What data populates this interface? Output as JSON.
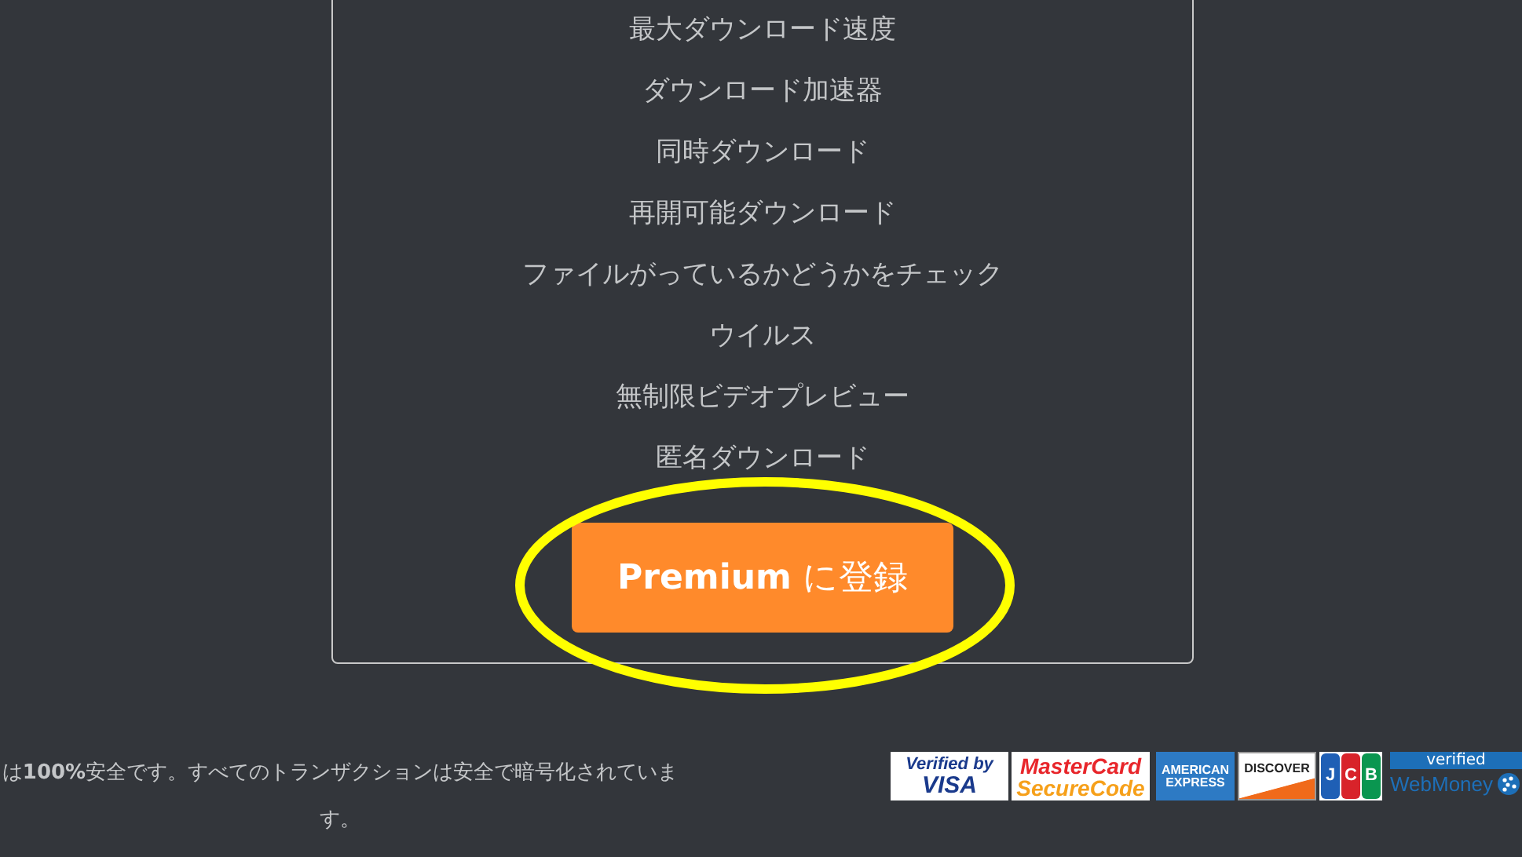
{
  "features": [
    "最大ダウンロード速度",
    "ダウンロード加速器",
    "同時ダウンロード",
    "再開可能ダウンロード",
    "ファイルがっているかどうかをチェック",
    "ウイルス",
    "無制限ビデオプレビュー",
    "匿名ダウンロード"
  ],
  "button": {
    "label": "**Premium** に登録"
  },
  "security_note": "は**100%**安全です。すべてのトランザクションは安全で暗号化されています。",
  "payment_logos": [
    {
      "kind": "visa",
      "lines": [
        "Verified by",
        "VISA"
      ]
    },
    {
      "kind": "mastercard",
      "lines": [
        "MasterCard",
        "SecureCode"
      ]
    },
    {
      "kind": "amex",
      "lines": [
        "AMERICAN",
        "EXPRESS"
      ]
    },
    {
      "kind": "discover",
      "lines": [
        "DISCOVER"
      ]
    },
    {
      "kind": "jcb",
      "lines": [
        "J",
        "C",
        "B"
      ]
    },
    {
      "kind": "webmoney",
      "lines": [
        "verified",
        "WebMoney"
      ]
    }
  ]
}
